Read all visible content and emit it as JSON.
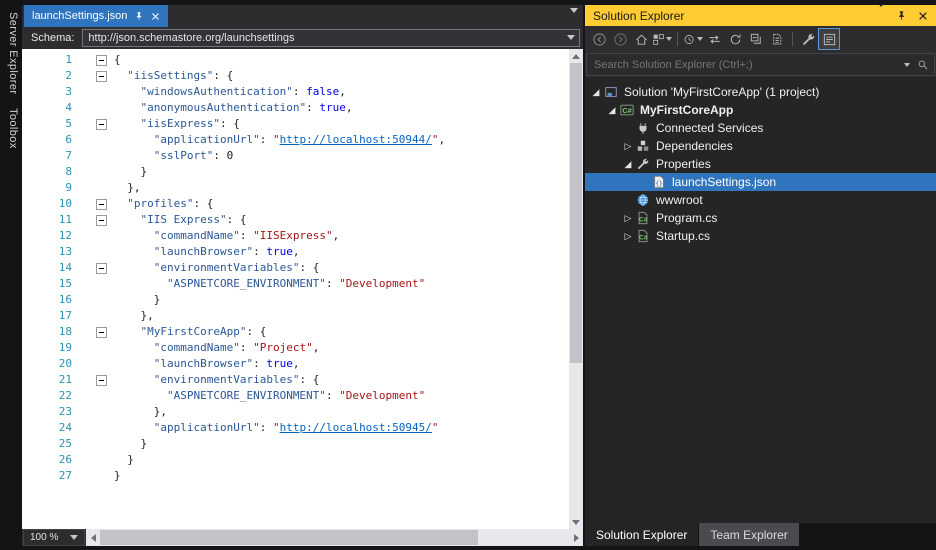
{
  "colors": {
    "accent": "#2f74bc",
    "title-active-bg": "#ffcc33",
    "chrome": "#2d2d30",
    "panel": "#252526",
    "frame": "#141417",
    "editor-bg": "#ffffff",
    "line-number": "#2b91af",
    "json-property": "#2b5797",
    "json-string": "#a31515",
    "json-keyword": "#0000e0",
    "json-url": "#0563c1"
  },
  "left_rail": {
    "tabs": [
      "Server Explorer",
      "Toolbox"
    ]
  },
  "editor": {
    "tab_title": "launchSettings.json",
    "schema_label": "Schema:",
    "schema_value": "http://json.schemastore.org/launchsettings",
    "zoom_value": "100 %",
    "code_lines": [
      {
        "n": 1,
        "fold": true,
        "tokens": [
          [
            "{",
            "d"
          ]
        ]
      },
      {
        "n": 2,
        "fold": true,
        "tokens": [
          [
            "  ",
            "d"
          ],
          [
            "\"iisSettings\"",
            "p"
          ],
          [
            ": {",
            "d"
          ]
        ]
      },
      {
        "n": 3,
        "fold": false,
        "tokens": [
          [
            "    ",
            "d"
          ],
          [
            "\"windowsAuthentication\"",
            "p"
          ],
          [
            ": ",
            "d"
          ],
          [
            "false",
            "k"
          ],
          [
            ",",
            "d"
          ]
        ]
      },
      {
        "n": 4,
        "fold": false,
        "tokens": [
          [
            "    ",
            "d"
          ],
          [
            "\"anonymousAuthentication\"",
            "p"
          ],
          [
            ": ",
            "d"
          ],
          [
            "true",
            "k"
          ],
          [
            ",",
            "d"
          ]
        ]
      },
      {
        "n": 5,
        "fold": true,
        "tokens": [
          [
            "    ",
            "d"
          ],
          [
            "\"iisExpress\"",
            "p"
          ],
          [
            ": {",
            "d"
          ]
        ]
      },
      {
        "n": 6,
        "fold": false,
        "tokens": [
          [
            "      ",
            "d"
          ],
          [
            "\"applicationUrl\"",
            "p"
          ],
          [
            ": ",
            "d"
          ],
          [
            "\"",
            "s"
          ],
          [
            "http://localhost:50944/",
            "u"
          ],
          [
            "\"",
            "s"
          ],
          [
            ",",
            "d"
          ]
        ]
      },
      {
        "n": 7,
        "fold": false,
        "tokens": [
          [
            "      ",
            "d"
          ],
          [
            "\"sslPort\"",
            "p"
          ],
          [
            ": ",
            "d"
          ],
          [
            "0",
            "n"
          ]
        ]
      },
      {
        "n": 8,
        "fold": false,
        "tokens": [
          [
            "    }",
            "d"
          ]
        ]
      },
      {
        "n": 9,
        "fold": false,
        "tokens": [
          [
            "  },",
            "d"
          ]
        ]
      },
      {
        "n": 10,
        "fold": true,
        "tokens": [
          [
            "  ",
            "d"
          ],
          [
            "\"profiles\"",
            "p"
          ],
          [
            ": {",
            "d"
          ]
        ]
      },
      {
        "n": 11,
        "fold": true,
        "tokens": [
          [
            "    ",
            "d"
          ],
          [
            "\"IIS Express\"",
            "p"
          ],
          [
            ": {",
            "d"
          ]
        ]
      },
      {
        "n": 12,
        "fold": false,
        "tokens": [
          [
            "      ",
            "d"
          ],
          [
            "\"commandName\"",
            "p"
          ],
          [
            ": ",
            "d"
          ],
          [
            "\"IISExpress\"",
            "s"
          ],
          [
            ",",
            "d"
          ]
        ]
      },
      {
        "n": 13,
        "fold": false,
        "tokens": [
          [
            "      ",
            "d"
          ],
          [
            "\"launchBrowser\"",
            "p"
          ],
          [
            ": ",
            "d"
          ],
          [
            "true",
            "k"
          ],
          [
            ",",
            "d"
          ]
        ]
      },
      {
        "n": 14,
        "fold": true,
        "tokens": [
          [
            "      ",
            "d"
          ],
          [
            "\"environmentVariables\"",
            "p"
          ],
          [
            ": {",
            "d"
          ]
        ]
      },
      {
        "n": 15,
        "fold": false,
        "tokens": [
          [
            "        ",
            "d"
          ],
          [
            "\"ASPNETCORE_ENVIRONMENT\"",
            "p"
          ],
          [
            ": ",
            "d"
          ],
          [
            "\"Development\"",
            "s"
          ]
        ]
      },
      {
        "n": 16,
        "fold": false,
        "tokens": [
          [
            "      }",
            "d"
          ]
        ]
      },
      {
        "n": 17,
        "fold": false,
        "tokens": [
          [
            "    },",
            "d"
          ]
        ]
      },
      {
        "n": 18,
        "fold": true,
        "tokens": [
          [
            "    ",
            "d"
          ],
          [
            "\"MyFirstCoreApp\"",
            "p"
          ],
          [
            ": {",
            "d"
          ]
        ]
      },
      {
        "n": 19,
        "fold": false,
        "tokens": [
          [
            "      ",
            "d"
          ],
          [
            "\"commandName\"",
            "p"
          ],
          [
            ": ",
            "d"
          ],
          [
            "\"Project\"",
            "s"
          ],
          [
            ",",
            "d"
          ]
        ]
      },
      {
        "n": 20,
        "fold": false,
        "tokens": [
          [
            "      ",
            "d"
          ],
          [
            "\"launchBrowser\"",
            "p"
          ],
          [
            ": ",
            "d"
          ],
          [
            "true",
            "k"
          ],
          [
            ",",
            "d"
          ]
        ]
      },
      {
        "n": 21,
        "fold": true,
        "tokens": [
          [
            "      ",
            "d"
          ],
          [
            "\"environmentVariables\"",
            "p"
          ],
          [
            ": {",
            "d"
          ]
        ]
      },
      {
        "n": 22,
        "fold": false,
        "tokens": [
          [
            "        ",
            "d"
          ],
          [
            "\"ASPNETCORE_ENVIRONMENT\"",
            "p"
          ],
          [
            ": ",
            "d"
          ],
          [
            "\"Development\"",
            "s"
          ]
        ]
      },
      {
        "n": 23,
        "fold": false,
        "tokens": [
          [
            "      },",
            "d"
          ]
        ]
      },
      {
        "n": 24,
        "fold": false,
        "tokens": [
          [
            "      ",
            "d"
          ],
          [
            "\"applicationUrl\"",
            "p"
          ],
          [
            ": ",
            "d"
          ],
          [
            "\"",
            "s"
          ],
          [
            "http://localhost:50945/",
            "u"
          ],
          [
            "\"",
            "s"
          ]
        ]
      },
      {
        "n": 25,
        "fold": false,
        "tokens": [
          [
            "    }",
            "d"
          ]
        ]
      },
      {
        "n": 26,
        "fold": false,
        "tokens": [
          [
            "  }",
            "d"
          ]
        ]
      },
      {
        "n": 27,
        "fold": false,
        "tokens": [
          [
            "}",
            "d"
          ]
        ]
      }
    ]
  },
  "solution_explorer": {
    "title": "Solution Explorer",
    "title_icons": [
      "chevron-down",
      "pin",
      "close"
    ],
    "toolbar": [
      {
        "name": "back"
      },
      {
        "name": "forward"
      },
      {
        "name": "home"
      },
      {
        "name": "switch-views",
        "caret": true
      },
      {
        "name": "separator"
      },
      {
        "name": "history",
        "caret": true
      },
      {
        "name": "sync-with-active-document"
      },
      {
        "name": "refresh"
      },
      {
        "name": "collapse-all"
      },
      {
        "name": "show-all-files"
      },
      {
        "name": "separator"
      },
      {
        "name": "properties"
      },
      {
        "name": "preview-selected-items",
        "pressed": true
      }
    ],
    "search_placeholder": "Search Solution Explorer (Ctrl+;)",
    "tree": [
      {
        "label": "Solution 'MyFirstCoreApp' (1 project)",
        "level": 0,
        "expander": "expanded",
        "icon": "solution",
        "bold": false,
        "selected": false
      },
      {
        "label": "MyFirstCoreApp",
        "level": 1,
        "expander": "expanded",
        "icon": "project-csharp",
        "bold": true,
        "selected": false
      },
      {
        "label": "Connected Services",
        "level": 2,
        "expander": "none",
        "icon": "connected-services",
        "bold": false,
        "selected": false
      },
      {
        "label": "Dependencies",
        "level": 2,
        "expander": "collapsed",
        "icon": "dependencies",
        "bold": false,
        "selected": false
      },
      {
        "label": "Properties",
        "level": 2,
        "expander": "expanded",
        "icon": "properties",
        "bold": false,
        "selected": false
      },
      {
        "label": "launchSettings.json",
        "level": 3,
        "expander": "none",
        "icon": "json-file",
        "bold": false,
        "selected": true
      },
      {
        "label": "wwwroot",
        "level": 2,
        "expander": "none",
        "icon": "globe",
        "bold": false,
        "selected": false
      },
      {
        "label": "Program.cs",
        "level": 2,
        "expander": "collapsed",
        "icon": "csharp-file",
        "bold": false,
        "selected": false
      },
      {
        "label": "Startup.cs",
        "level": 2,
        "expander": "collapsed",
        "icon": "csharp-file",
        "bold": false,
        "selected": false
      }
    ],
    "bottom_tabs": [
      {
        "label": "Solution Explorer",
        "active": true
      },
      {
        "label": "Team Explorer",
        "active": false
      }
    ]
  }
}
